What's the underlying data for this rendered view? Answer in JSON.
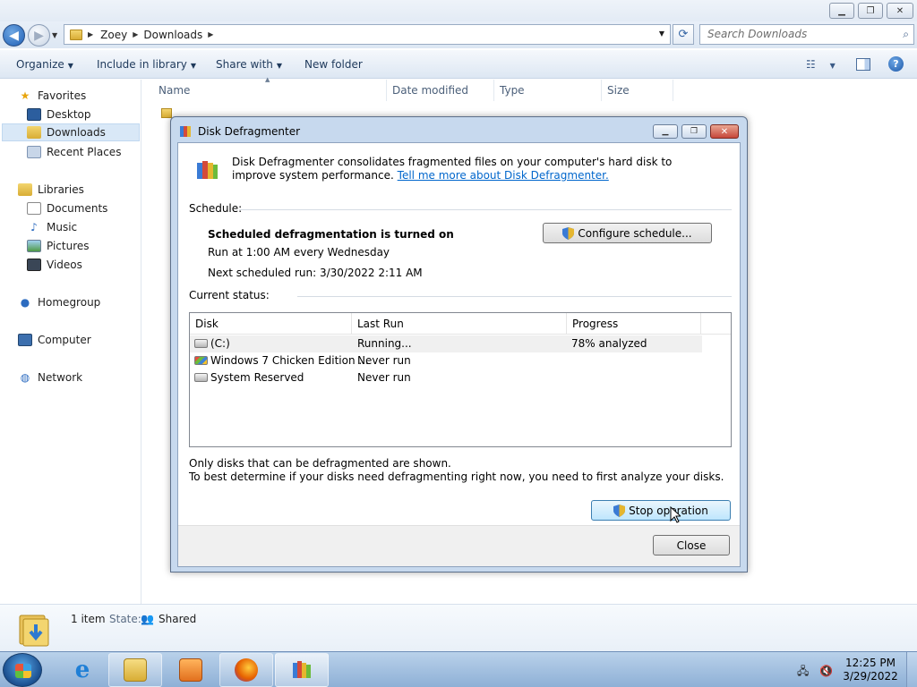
{
  "explorer": {
    "breadcrumb": [
      "Zoey",
      "Downloads"
    ],
    "search_placeholder": "Search Downloads",
    "commands": {
      "organize": "Organize",
      "include_in_library": "Include in library",
      "share_with": "Share with",
      "new_folder": "New folder"
    },
    "nav": {
      "favorites": "Favorites",
      "desktop": "Desktop",
      "downloads": "Downloads",
      "recent_places": "Recent Places",
      "libraries": "Libraries",
      "documents": "Documents",
      "music": "Music",
      "pictures": "Pictures",
      "videos": "Videos",
      "homegroup": "Homegroup",
      "computer": "Computer",
      "network": "Network"
    },
    "columns": {
      "name": "Name",
      "date_modified": "Date modified",
      "type": "Type",
      "size": "Size"
    },
    "details": {
      "item_count": "1 item",
      "state_label": "State:",
      "state_value": "Shared"
    }
  },
  "dialog": {
    "title": "Disk Defragmenter",
    "intro_text": "Disk Defragmenter consolidates fragmented files on your computer's hard disk to improve system performance.",
    "intro_link": "Tell me more about Disk Defragmenter.",
    "schedule_label": "Schedule:",
    "schedule_status": "Scheduled defragmentation is turned on",
    "schedule_run_at": "Run at 1:00 AM every Wednesday",
    "schedule_next": "Next scheduled run: 3/30/2022 2:11 AM",
    "configure_button": "Configure schedule...",
    "current_status_label": "Current status:",
    "columns": {
      "disk": "Disk",
      "last_run": "Last Run",
      "progress": "Progress"
    },
    "disks": [
      {
        "disk": "(C:)",
        "last_run": "Running...",
        "progress": "78% analyzed",
        "icon": "drive-icon"
      },
      {
        "disk": "Windows 7 Chicken Edition ...",
        "last_run": "Never run",
        "progress": "",
        "icon": "windows-drive-icon"
      },
      {
        "disk": "System Reserved",
        "last_run": "Never run",
        "progress": "",
        "icon": "drive-icon"
      }
    ],
    "note_line1": "Only disks that can be defragmented are shown.",
    "note_line2": "To best determine if your disks need defragmenting right now, you need to first analyze your disks.",
    "stop_button": "Stop operation",
    "close_button": "Close"
  },
  "taskbar": {
    "time": "12:25 PM",
    "date": "3/29/2022"
  },
  "colors": {
    "accent": "#3c7fb1",
    "link": "#0066cc",
    "taskbar": "#8eb0d6"
  }
}
